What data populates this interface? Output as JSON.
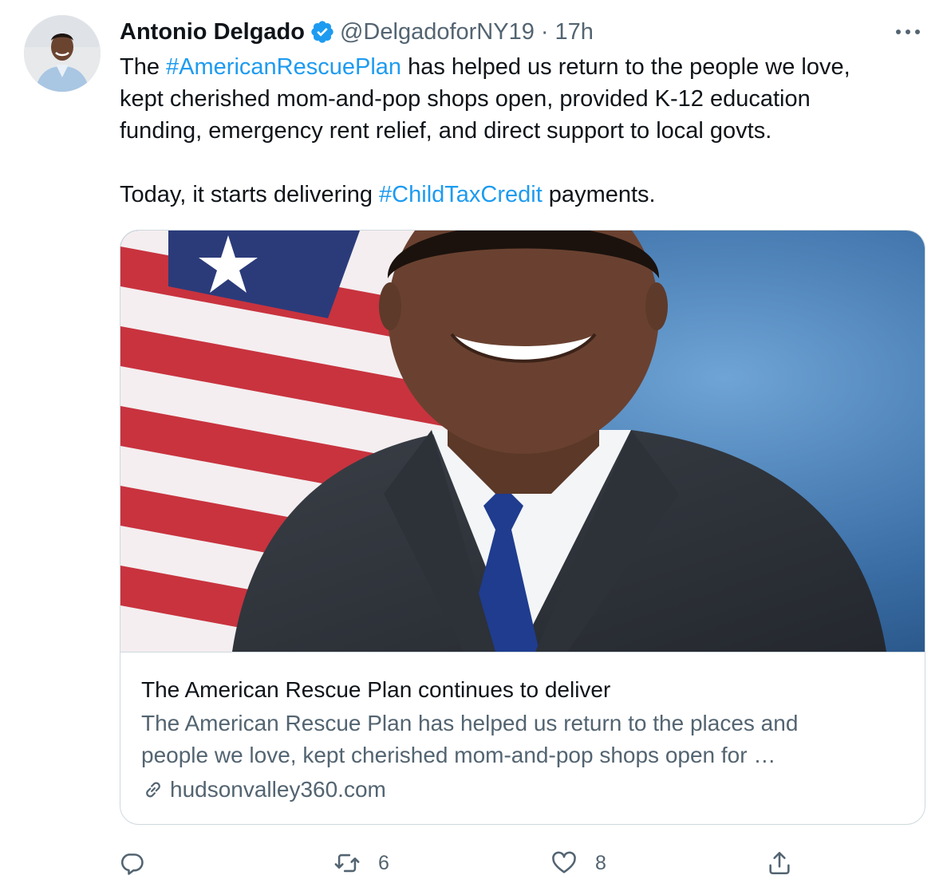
{
  "tweet": {
    "author": {
      "display_name": "Antonio Delgado",
      "handle": "@DelgadoforNY19",
      "separator": "·",
      "time": "17h",
      "verified_icon": "verified-badge-icon"
    },
    "text_segments": [
      {
        "type": "text",
        "value": "The "
      },
      {
        "type": "hashtag",
        "value": "#AmericanRescuePlan"
      },
      {
        "type": "text",
        "value": " has helped us return to the people we love,\nkept cherished mom-and-pop shops open, provided K-12 education\nfunding, emergency rent relief, and direct support to local govts.\n\nToday, it starts delivering "
      },
      {
        "type": "hashtag",
        "value": "#ChildTaxCredit"
      },
      {
        "type": "text",
        "value": " payments."
      }
    ],
    "card": {
      "title": "The American Rescue Plan continues to deliver",
      "description_line1": "The American Rescue Plan has helped us return to the places and",
      "description_line2": "people we love, kept cherished mom-and-pop shops open for …",
      "domain": "hudsonvalley360.com"
    },
    "actions": {
      "reply_count": "",
      "retweet_count": "6",
      "like_count": "8"
    }
  },
  "colors": {
    "link": "#1d9bf0",
    "secondary_text": "#536471",
    "border": "#cfd9de"
  }
}
